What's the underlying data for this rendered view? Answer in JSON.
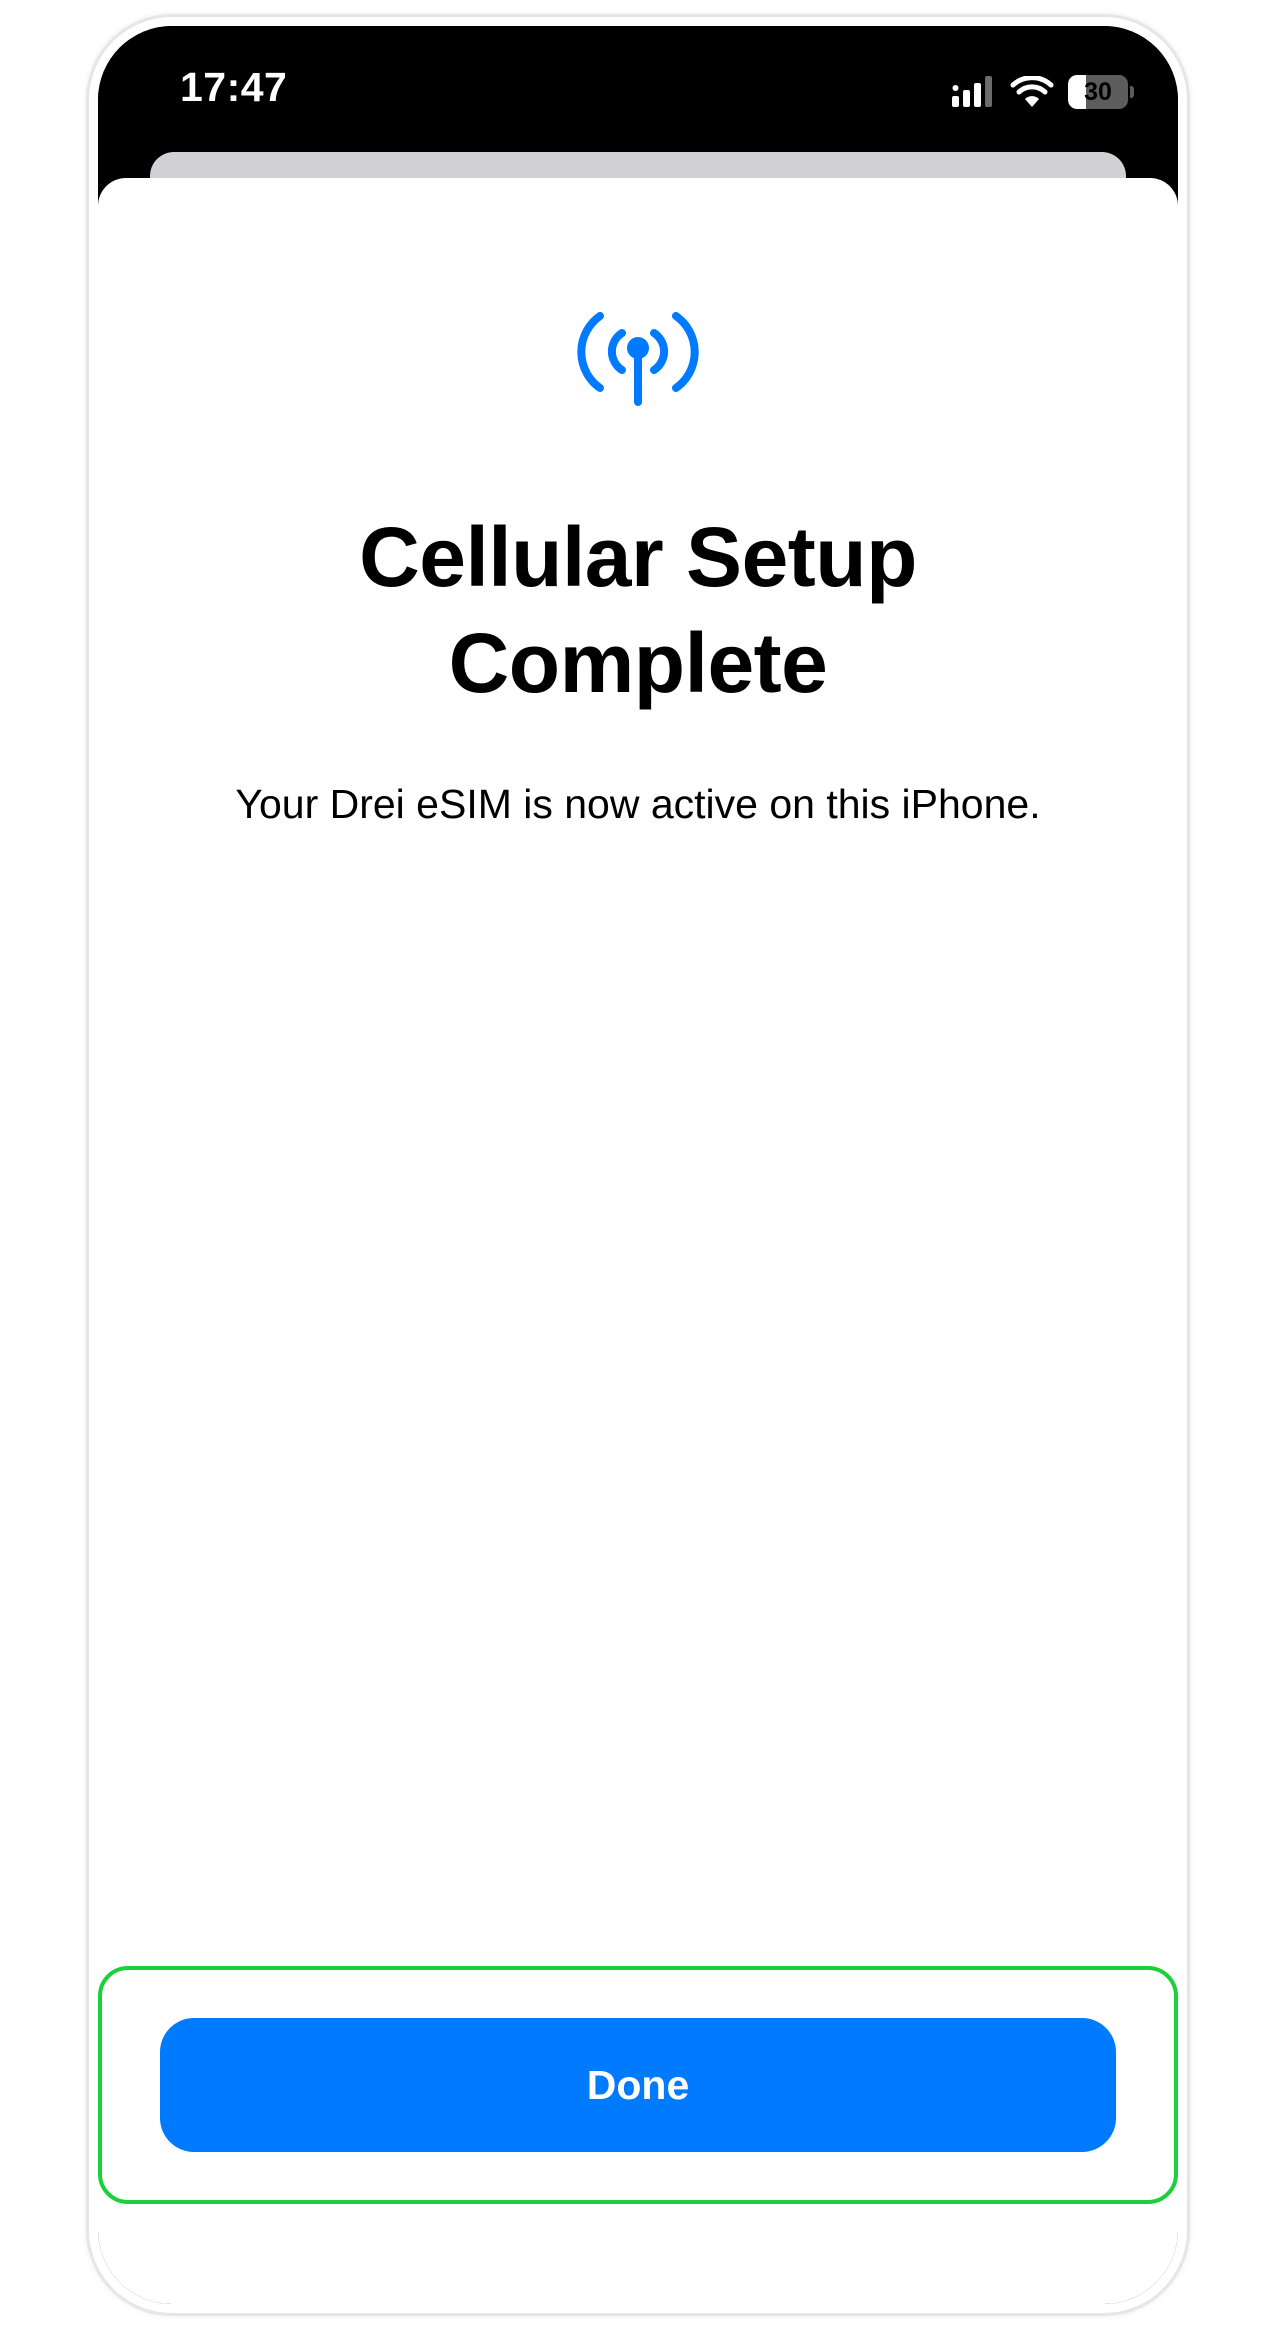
{
  "status_bar": {
    "time": "17:47",
    "battery_level": "30",
    "battery_fraction": 0.3,
    "icons": [
      "signal-icon",
      "wifi-icon",
      "battery-icon"
    ]
  },
  "sheet": {
    "icon": "antenna-icon",
    "title": "Cellular Setup Complete",
    "subtitle": "Your Drei eSIM is now active on this iPhone.",
    "done_label": "Done"
  },
  "colors": {
    "accent": "#007aff",
    "highlight": "#19d13a",
    "status_bar_bg": "#000000",
    "sheet_bg": "#ffffff"
  }
}
